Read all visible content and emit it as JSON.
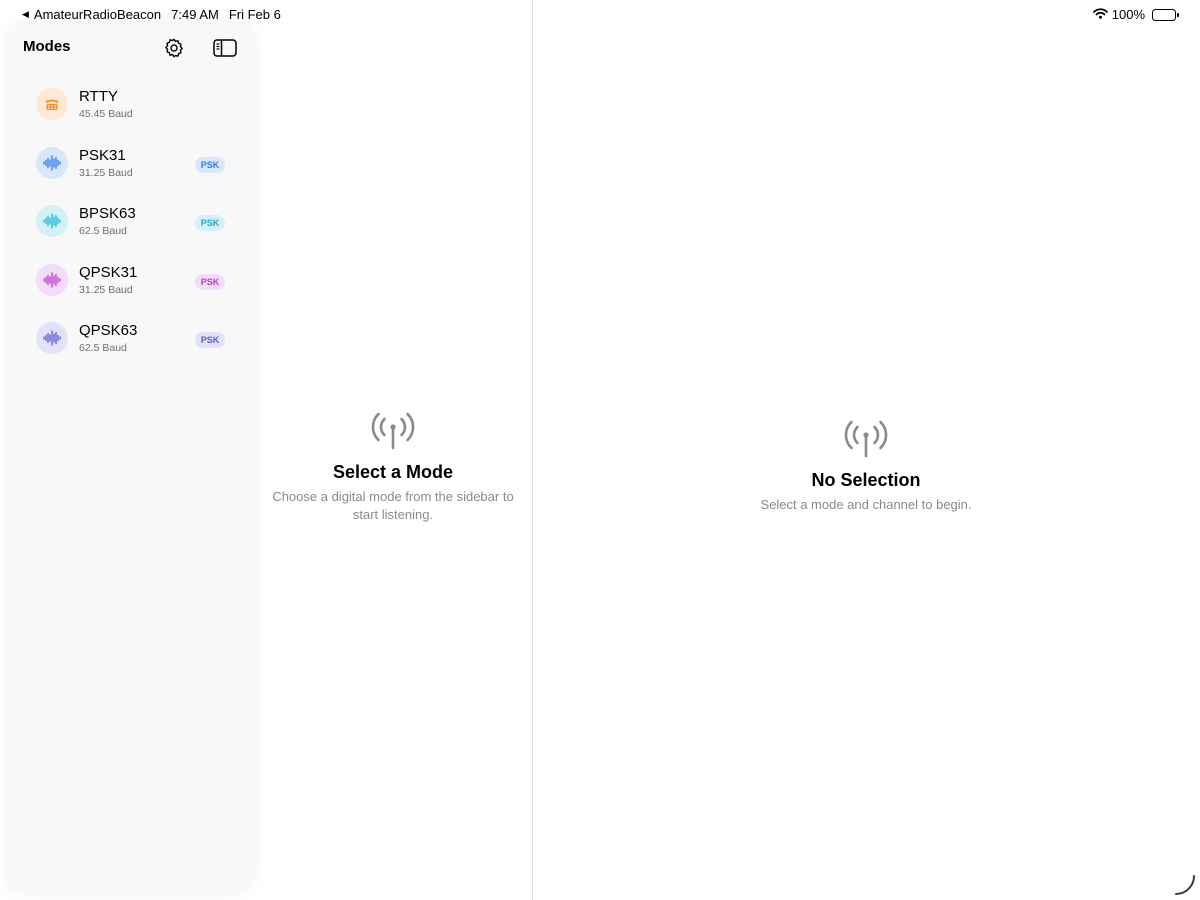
{
  "status_bar": {
    "back_app": "AmateurRadioBeacon",
    "time": "7:49 AM",
    "date": "Fri Feb 6",
    "battery": "100%"
  },
  "sidebar": {
    "title": "Modes",
    "modes": [
      {
        "name": "RTTY",
        "baud": "45.45 Baud",
        "icon": "teletype-icon",
        "color": "#ff8a1f",
        "bg": "#ffe8d4",
        "badge": ""
      },
      {
        "name": "PSK31",
        "baud": "31.25 Baud",
        "icon": "waveform-icon",
        "color": "#2f7cf0",
        "bg": "#d9e7fb",
        "badge": "PSK",
        "badge_color": "#2f7cf0",
        "badge_bg": "#d9e7fb"
      },
      {
        "name": "BPSK63",
        "baud": "62.5 Baud",
        "icon": "waveform-icon",
        "color": "#1fb9d4",
        "bg": "#d4f1f7",
        "badge": "PSK",
        "badge_color": "#1fa9c4",
        "badge_bg": "#d4f1f7"
      },
      {
        "name": "QPSK31",
        "baud": "31.25 Baud",
        "icon": "waveform-icon",
        "color": "#c03ad6",
        "bg": "#f3dcf7",
        "badge": "PSK",
        "badge_color": "#c03ad6",
        "badge_bg": "#f3dcf7"
      },
      {
        "name": "QPSK63",
        "baud": "62.5 Baud",
        "icon": "waveform-icon",
        "color": "#5b5bd6",
        "bg": "#e2e2f8",
        "badge": "PSK",
        "badge_color": "#5b5bd6",
        "badge_bg": "#e2e2f8"
      }
    ]
  },
  "content": {
    "title": "Select a Mode",
    "subtitle": "Choose a digital mode from the sidebar to start listening."
  },
  "detail": {
    "title": "No Selection",
    "subtitle": "Select a mode and channel to begin."
  }
}
